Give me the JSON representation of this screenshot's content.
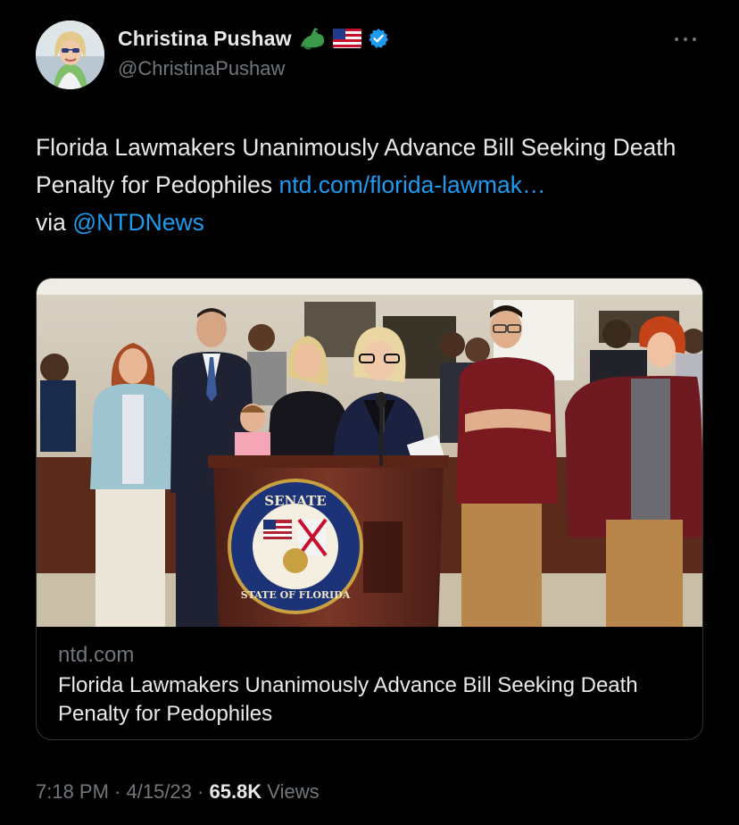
{
  "author": {
    "display_name": "Christina Pushaw",
    "handle": "@ChristinaPushaw",
    "badges": [
      "alligator-emoji-icon",
      "us-flag-icon",
      "verified-badge-icon"
    ]
  },
  "tweet": {
    "text_part1": "Florida Lawmakers Unanimously Advance Bill Seeking Death Penalty for Pedophiles ",
    "link_text": "ntd.com/florida-lawmak…",
    "text_part2": "via ",
    "mention": "@NTDNews"
  },
  "card": {
    "image_icon": "press-conference-photo",
    "seal_top_text": "SENATE",
    "seal_bottom_text": "STATE OF FLORIDA",
    "domain": "ntd.com",
    "title": "Florida Lawmakers Unanimously Advance Bill Seeking Death Penalty for Pedophiles"
  },
  "meta": {
    "time": "7:18 PM",
    "sep1": " · ",
    "date": "4/15/23",
    "sep2": " · ",
    "views_count": "65.8K",
    "views_label": " Views"
  },
  "colors": {
    "background": "#000000",
    "text": "#e7e9ea",
    "secondary": "#71767b",
    "link": "#1d9bf0",
    "border": "#2f3336"
  }
}
